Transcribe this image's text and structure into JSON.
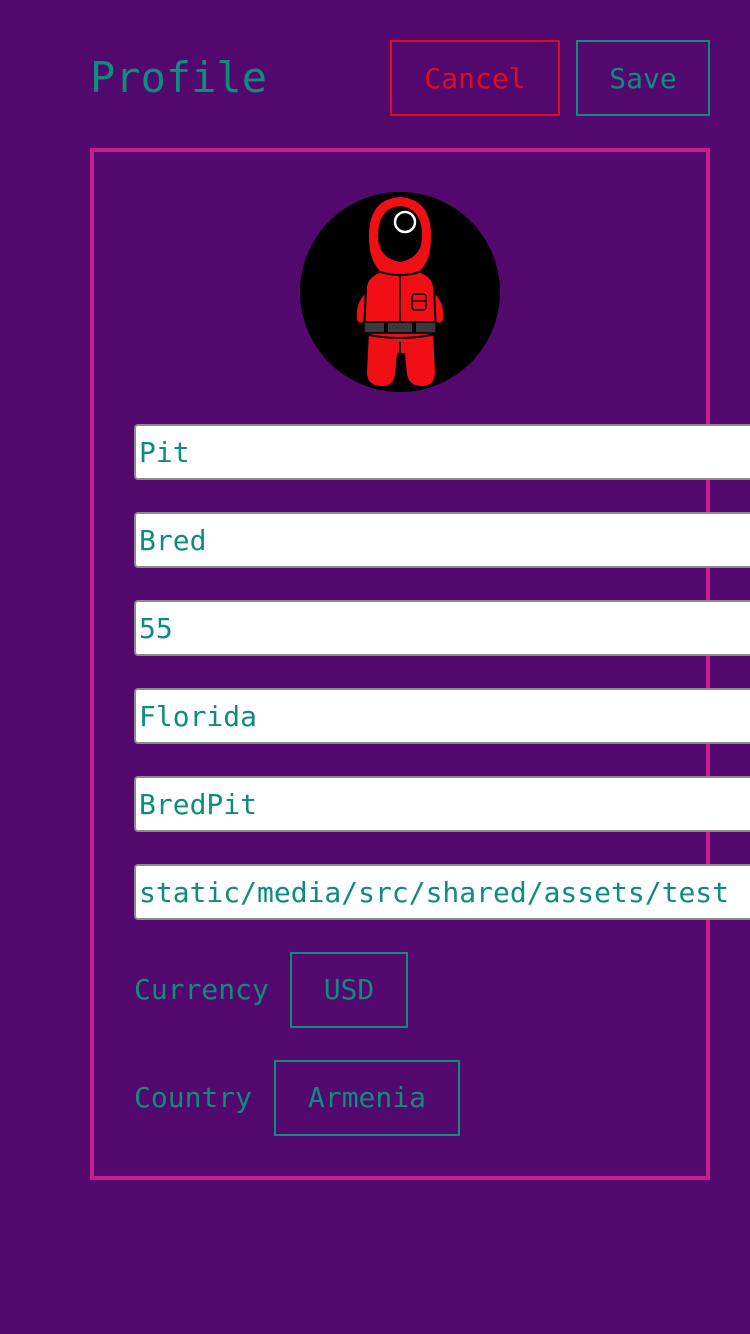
{
  "header": {
    "title": "Profile",
    "cancel_label": "Cancel",
    "save_label": "Save"
  },
  "colors": {
    "background": "#53086e",
    "accent_text": "#0e8c80",
    "cancel": "#d70f1f",
    "card_border": "#c71d8e"
  },
  "profile": {
    "avatar_icon": "squid-game-guard-avatar",
    "fields": {
      "first_name": "Pit",
      "last_name": "Bred",
      "age": "55",
      "location": "Florida",
      "username": "BredPit",
      "avatar_path": "static/media/src/shared/assets/test"
    },
    "currency": {
      "label": "Currency",
      "value": "USD"
    },
    "country": {
      "label": "Country",
      "value": "Armenia"
    }
  }
}
